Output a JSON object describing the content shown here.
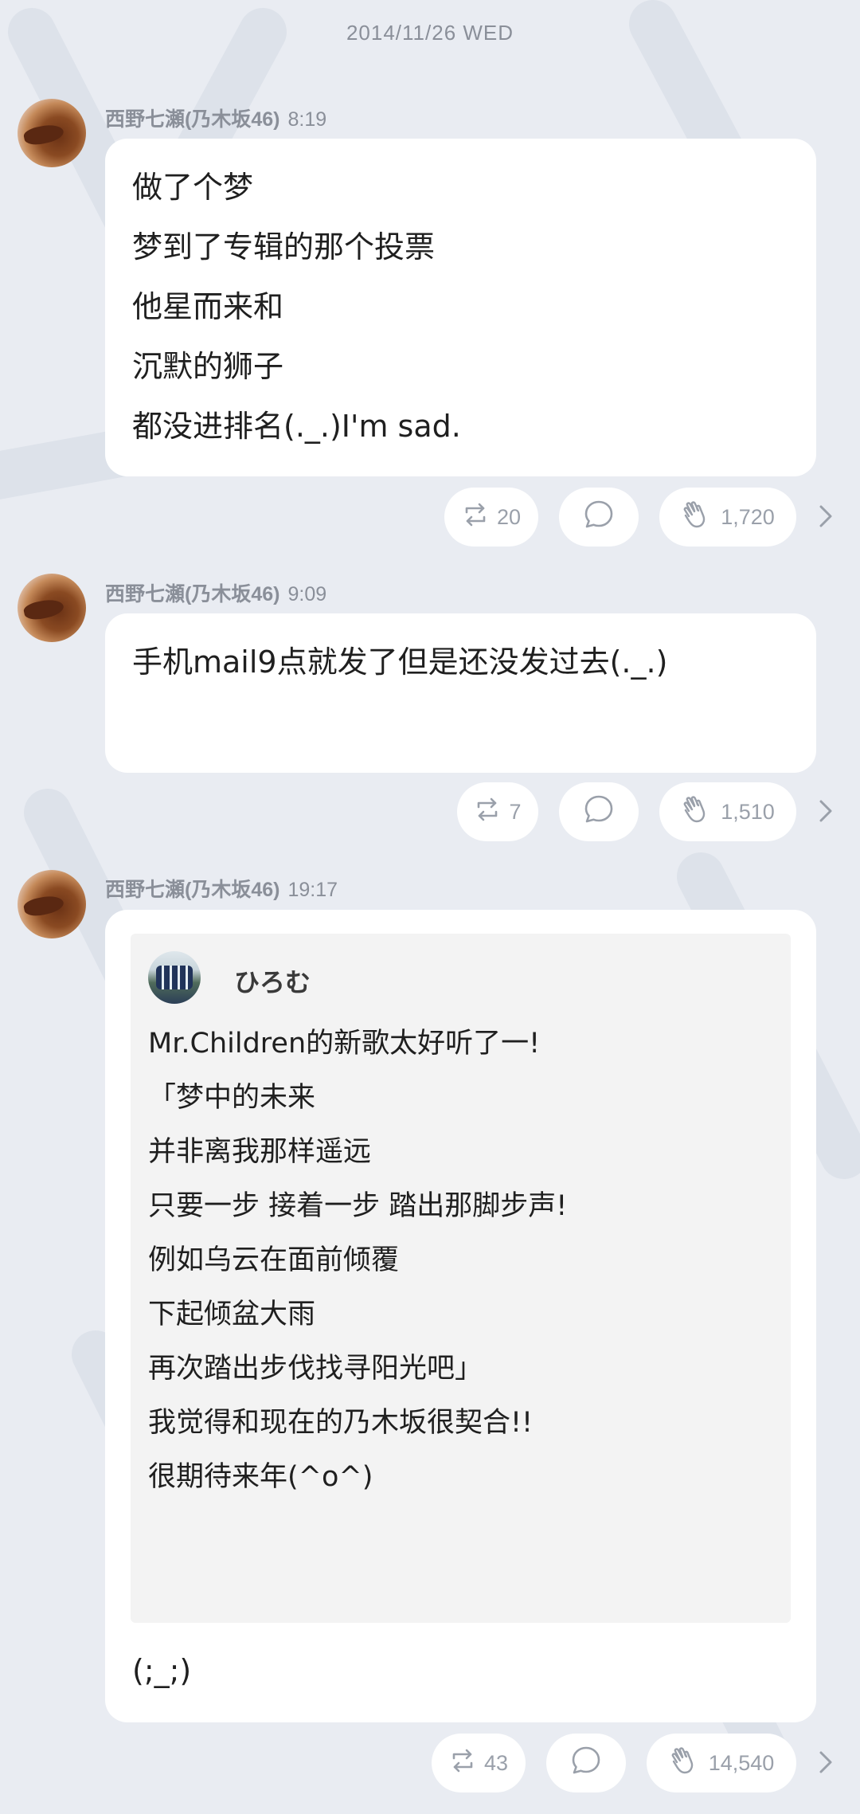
{
  "date_header": "2014/11/26 WED",
  "posts": [
    {
      "author": "西野七瀬(乃木坂46)",
      "time": "8:19",
      "lines": [
        "做了个梦",
        "梦到了专辑的那个投票",
        "他星而来和",
        "沉默的狮子",
        "都没进排名(._.)I'm sad."
      ],
      "repost_count": "20",
      "clap_count": "1,720"
    },
    {
      "author": "西野七瀬(乃木坂46)",
      "time": "9:09",
      "lines": [
        "手机mail9点就发了但是还没发过去(._.)"
      ],
      "repost_count": "7",
      "clap_count": "1,510"
    },
    {
      "author": "西野七瀬(乃木坂46)",
      "time": "19:17",
      "quote": {
        "name": "ひろむ",
        "lines": [
          "Mr.Children的新歌太好听了一!",
          "「梦中的未来",
          "并非离我那样遥远",
          "只要一步 接着一步 踏出那脚步声!",
          "例如乌云在面前倾覆",
          "下起倾盆大雨",
          "再次踏出步伐找寻阳光吧」",
          "我觉得和现在的乃木坂很契合!!",
          "很期待来年(^o^)"
        ]
      },
      "lines": [
        "(;_;)"
      ],
      "repost_count": "43",
      "clap_count": "14,540"
    }
  ],
  "colors": {
    "background": "#e9ecf2",
    "bubble": "#ffffff",
    "meta_text": "#8a8f99",
    "icon": "#9aa0aa"
  },
  "icons": [
    "repost-icon",
    "comment-icon",
    "clap-icon",
    "chevron-right-icon"
  ]
}
